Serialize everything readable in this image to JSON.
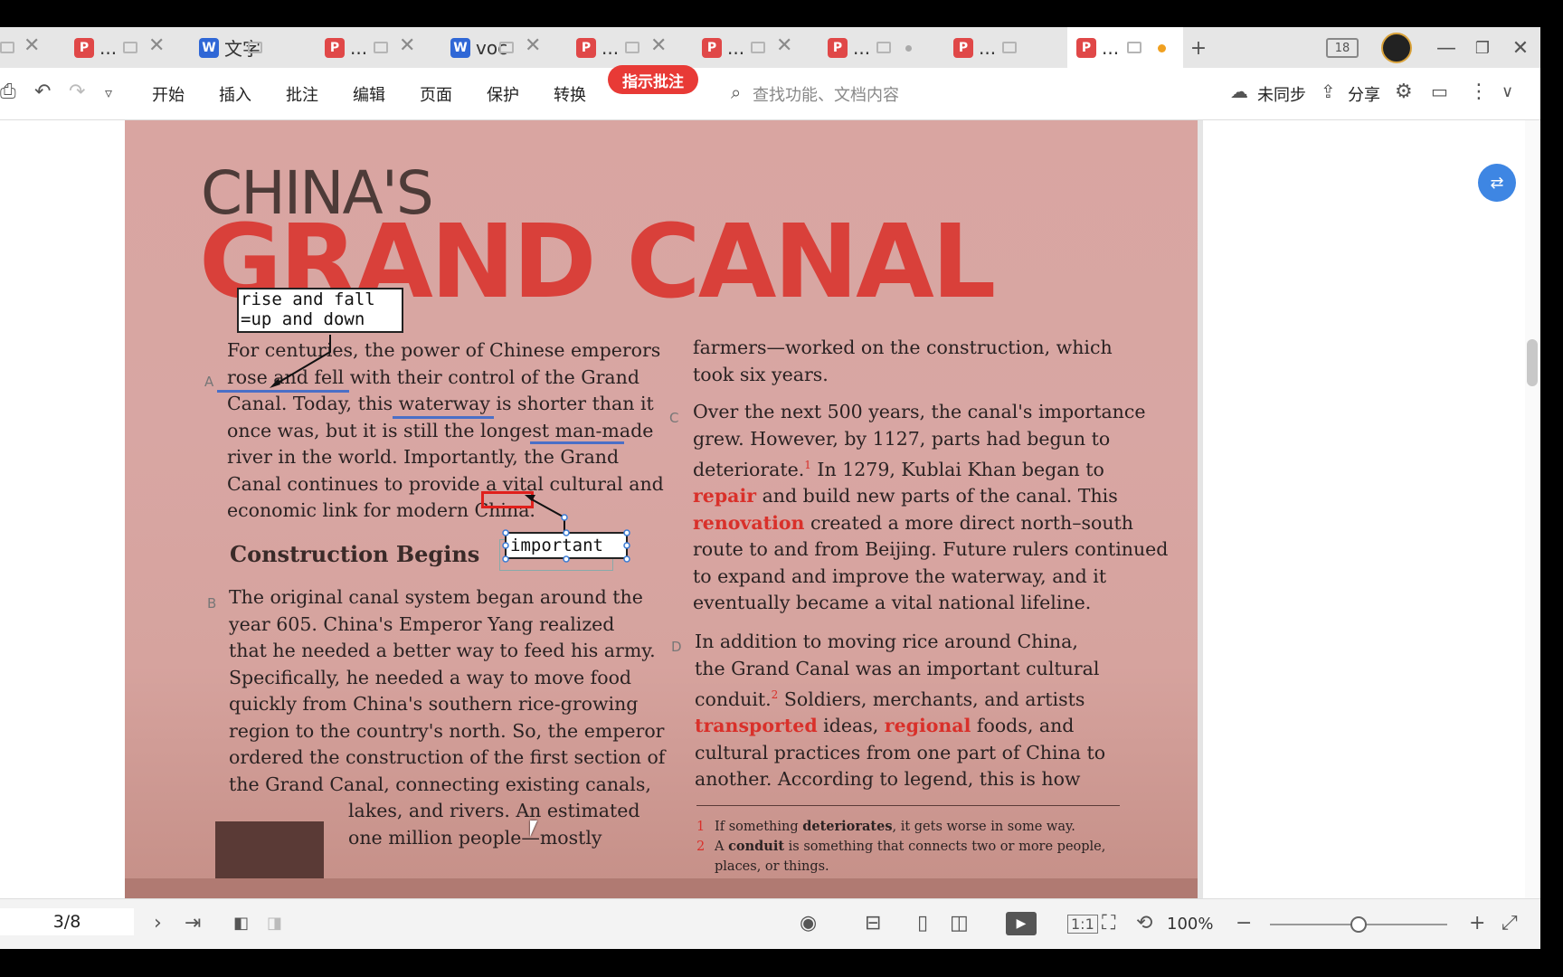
{
  "tabs": [
    {
      "icon": "pdf",
      "label": "..."
    },
    {
      "icon": "doc",
      "label": "文字"
    },
    {
      "icon": "pdf",
      "label": "..."
    },
    {
      "icon": "doc",
      "label": "voc"
    },
    {
      "icon": "pdf",
      "label": "..."
    },
    {
      "icon": "pdf",
      "label": "..."
    },
    {
      "icon": "pdf",
      "label": "..."
    },
    {
      "icon": "pdf",
      "label": "..."
    },
    {
      "icon": "pdf",
      "label": "..."
    }
  ],
  "tab_new": "+",
  "window": {
    "page_count_badge": "18"
  },
  "toolbar": {
    "menus": [
      "开始",
      "插入",
      "批注",
      "编辑",
      "页面",
      "保护",
      "转换"
    ],
    "highlight_button": "指示批注",
    "search_placeholder": "查找功能、文档内容",
    "sync": "未同步",
    "share": "分享"
  },
  "document": {
    "title_line1": "CHINA'S",
    "title_line2": "GRAND CANAL",
    "para_a_letter": "A",
    "para_a": [
      "For centuries, the power of Chinese emperors",
      "rose and fell with their control of the Grand",
      "Canal. Today, this waterway is shorter than it",
      "once was, but it is still the longest man-made",
      "river in the world. Importantly, the Grand",
      "Canal continues to provide a vital cultural and",
      "economic link for modern China."
    ],
    "heading": "Construction Begins",
    "para_b_letter": "B",
    "para_b": [
      "The original canal system began around the",
      "year 605. China's Emperor Yang realized",
      "that he needed a better way to feed his army.",
      "Specifically, he needed a way to move food",
      "quickly from China's southern rice-growing",
      "region to the country's north. So, the emperor",
      "ordered the construction of the first section of",
      "the Grand Canal, connecting existing canals,"
    ],
    "para_b_tail": [
      "lakes, and rivers. An estimated",
      "one million people—mostly"
    ],
    "col2_top": [
      "farmers—worked on the construction, which",
      "took six years."
    ],
    "para_c_letter": "C",
    "para_c": {
      "l1": "Over the next 500 years, the canal's importance",
      "l2": "grew. However, by 1127, parts had begun to",
      "l3a": "deteriorate.",
      "l3sup": "1",
      "l3b": " In 1279, Kublai Khan began to",
      "l4red": "repair",
      "l4": " and build new parts of the canal. This",
      "l5red": "renovation",
      "l5": " created a more direct north–south",
      "l6": "route to and from Beijing. Future rulers continued",
      "l7": "to expand and improve the waterway, and it",
      "l8": "eventually became a vital national lifeline."
    },
    "para_d_letter": "D",
    "para_d": {
      "l1": "In addition to moving rice around China,",
      "l2": "the Grand Canal was an important cultural",
      "l3a": "conduit.",
      "l3sup": "2",
      "l3b": " Soldiers, merchants, and artists",
      "l4red": "transported",
      "l4": " ideas, ",
      "l4red2": "regional",
      "l4b": " foods, and",
      "l5": "cultural practices from one part of China to",
      "l6": "another. According to legend, this is how"
    },
    "footnotes": [
      {
        "n": "1",
        "pre": "If something ",
        "bold": "deteriorates",
        "post": ", it gets worse in some way."
      },
      {
        "n": "2",
        "pre": "A ",
        "bold": "conduit",
        "post": " is something that connects two or more people,",
        "line2": "places, or things."
      }
    ],
    "annotations": {
      "note1_line1": "rise and fall",
      "note1_line2": "=up and down",
      "note2": "important"
    }
  },
  "statusbar": {
    "page": "3/8",
    "zoom": "100%"
  }
}
